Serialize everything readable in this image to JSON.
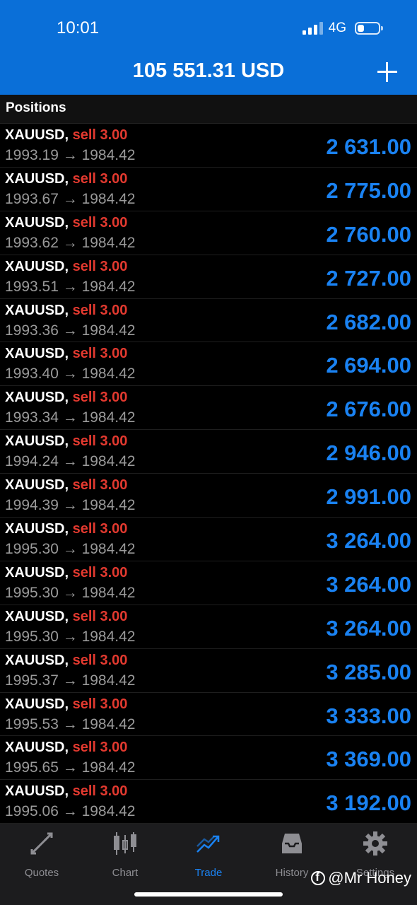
{
  "status": {
    "time": "10:01",
    "network": "4G"
  },
  "header": {
    "balance": "105 551.31 USD"
  },
  "section": {
    "title": "Positions"
  },
  "positions": [
    {
      "symbol": "XAUUSD,",
      "side": "sell 3.00",
      "prices": "1993.19 → 1984.42",
      "profit": "2 631.00"
    },
    {
      "symbol": "XAUUSD,",
      "side": "sell 3.00",
      "prices": "1993.67 → 1984.42",
      "profit": "2 775.00"
    },
    {
      "symbol": "XAUUSD,",
      "side": "sell 3.00",
      "prices": "1993.62 → 1984.42",
      "profit": "2 760.00"
    },
    {
      "symbol": "XAUUSD,",
      "side": "sell 3.00",
      "prices": "1993.51 → 1984.42",
      "profit": "2 727.00"
    },
    {
      "symbol": "XAUUSD,",
      "side": "sell 3.00",
      "prices": "1993.36 → 1984.42",
      "profit": "2 682.00"
    },
    {
      "symbol": "XAUUSD,",
      "side": "sell 3.00",
      "prices": "1993.40 → 1984.42",
      "profit": "2 694.00"
    },
    {
      "symbol": "XAUUSD,",
      "side": "sell 3.00",
      "prices": "1993.34 → 1984.42",
      "profit": "2 676.00"
    },
    {
      "symbol": "XAUUSD,",
      "side": "sell 3.00",
      "prices": "1994.24 → 1984.42",
      "profit": "2 946.00"
    },
    {
      "symbol": "XAUUSD,",
      "side": "sell 3.00",
      "prices": "1994.39 → 1984.42",
      "profit": "2 991.00"
    },
    {
      "symbol": "XAUUSD,",
      "side": "sell 3.00",
      "prices": "1995.30 → 1984.42",
      "profit": "3 264.00"
    },
    {
      "symbol": "XAUUSD,",
      "side": "sell 3.00",
      "prices": "1995.30 → 1984.42",
      "profit": "3 264.00"
    },
    {
      "symbol": "XAUUSD,",
      "side": "sell 3.00",
      "prices": "1995.30 → 1984.42",
      "profit": "3 264.00"
    },
    {
      "symbol": "XAUUSD,",
      "side": "sell 3.00",
      "prices": "1995.37 → 1984.42",
      "profit": "3 285.00"
    },
    {
      "symbol": "XAUUSD,",
      "side": "sell 3.00",
      "prices": "1995.53 → 1984.42",
      "profit": "3 333.00"
    },
    {
      "symbol": "XAUUSD,",
      "side": "sell 3.00",
      "prices": "1995.65 → 1984.42",
      "profit": "3 369.00"
    },
    {
      "symbol": "XAUUSD,",
      "side": "sell 3.00",
      "prices": "1995.06 → 1984.42",
      "profit": "3 192.00"
    }
  ],
  "tabs": [
    {
      "label": "Quotes",
      "icon": "quotes-icon"
    },
    {
      "label": "Chart",
      "icon": "candlestick-icon"
    },
    {
      "label": "Trade",
      "icon": "trade-icon"
    },
    {
      "label": "History",
      "icon": "history-icon"
    },
    {
      "label": "Settings",
      "icon": "gear-icon"
    }
  ],
  "watermark": "@Mr Honey",
  "colors": {
    "header": "#0a6fd8",
    "profit": "#1a82f2",
    "sell": "#e2392f",
    "active_tab": "#1a82f2"
  }
}
